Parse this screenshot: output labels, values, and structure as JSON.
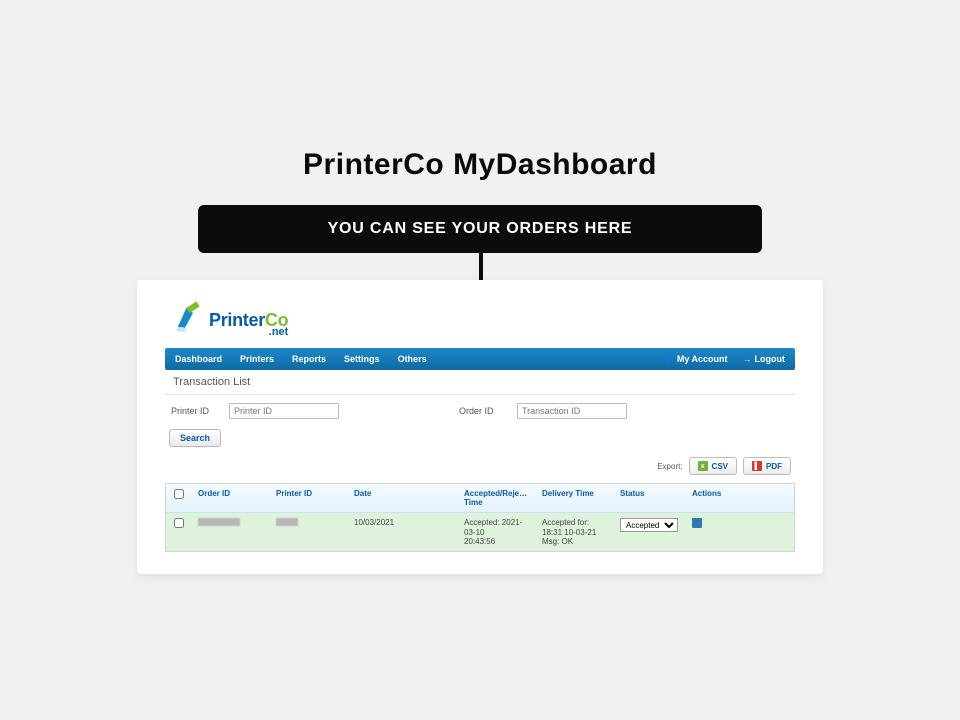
{
  "heading": "PrinterCo MyDashboard",
  "callout": "YOU CAN SEE YOUR ORDERS HERE",
  "logo": {
    "brand": "Printer",
    "brand_suffix": "Co",
    "tld": ".net"
  },
  "nav": {
    "items": [
      "Dashboard",
      "Printers",
      "Reports",
      "Settings",
      "Others"
    ],
    "my_account": "My Account",
    "logout": "Logout"
  },
  "section_title": "Transaction List",
  "filters": {
    "printer_label": "Printer ID",
    "printer_placeholder": "Printer ID",
    "order_label": "Order ID",
    "order_placeholder": "Transaction ID",
    "search": "Search"
  },
  "export": {
    "label": "Export:",
    "csv": "CSV",
    "pdf": "PDF"
  },
  "table": {
    "columns": {
      "order_id": "Order ID",
      "printer_id": "Printer ID",
      "date": "Date",
      "acc_rej": "Accepted/Rejected Time",
      "delivery": "Delivery Time",
      "status": "Status",
      "actions": "Actions"
    },
    "row": {
      "date": "10/03/2021",
      "acc_line1": "Accepted: 2021-03-10",
      "acc_line2": "20:43:56",
      "del_line1": "Accepted for: 18:31 10-03-21",
      "del_line2": "Msg: OK",
      "status_value": "Accepted"
    }
  }
}
